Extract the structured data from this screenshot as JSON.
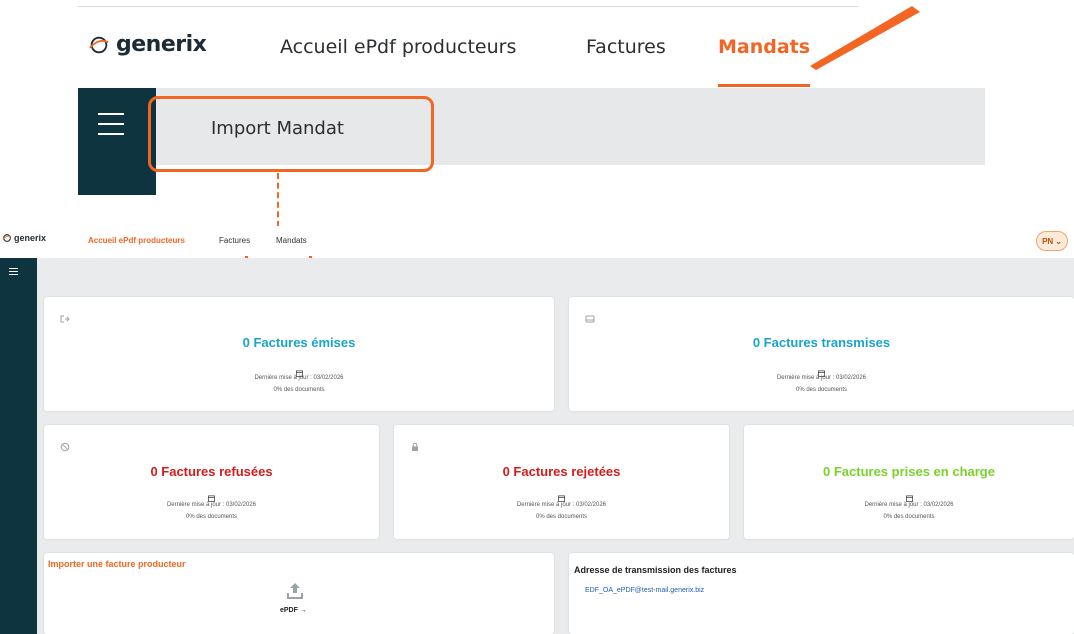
{
  "brand": {
    "name": "generix",
    "accent": "#f26522",
    "sidebar_color": "#0e3440"
  },
  "zoom": {
    "nav": [
      "Accueil ePdf producteurs",
      "Factures",
      "Mandats"
    ],
    "active_nav": "Mandats",
    "import_label": "Import Mandat"
  },
  "header": {
    "nav": [
      "Accueil ePdf producteurs",
      "Factures",
      "Mandats"
    ],
    "active_nav": "Accueil ePdf producteurs",
    "avatar": "PN"
  },
  "cards": [
    {
      "title": "0 Factures émises",
      "color": "#1aa4c8",
      "icon": "sign-out-icon",
      "updated": "Dernière mise à jour : 03/02/2026",
      "percent": "0% des documents"
    },
    {
      "title": "0 Factures transmises",
      "color": "#1aa4c8",
      "icon": "inbox-icon",
      "updated": "Dernière mise à jour : 03/02/2026",
      "percent": "0% des documents"
    },
    {
      "title": "0 Factures refusées",
      "color": "#d41c1c",
      "icon": "ban-icon",
      "updated": "Dernière mise à jour : 03/02/2026",
      "percent": "0% des documents"
    },
    {
      "title": "0 Factures rejetées",
      "color": "#d41c1c",
      "icon": "lock-icon",
      "updated": "Dernière mise à jour : 03/02/2026",
      "percent": "0% des documents"
    },
    {
      "title": "0 Factures prises en charge",
      "color": "#7ad12b",
      "icon": "",
      "updated": "Dernière mise à jour : 03/02/2026",
      "percent": "0% des documents"
    }
  ],
  "import_panel": {
    "title": "Importer une facture producteur",
    "button": "ePDF →"
  },
  "address_panel": {
    "title": "Adresse de transmission des factures",
    "email": "EDF_OA_ePDF@test-mail.generix.biz"
  }
}
